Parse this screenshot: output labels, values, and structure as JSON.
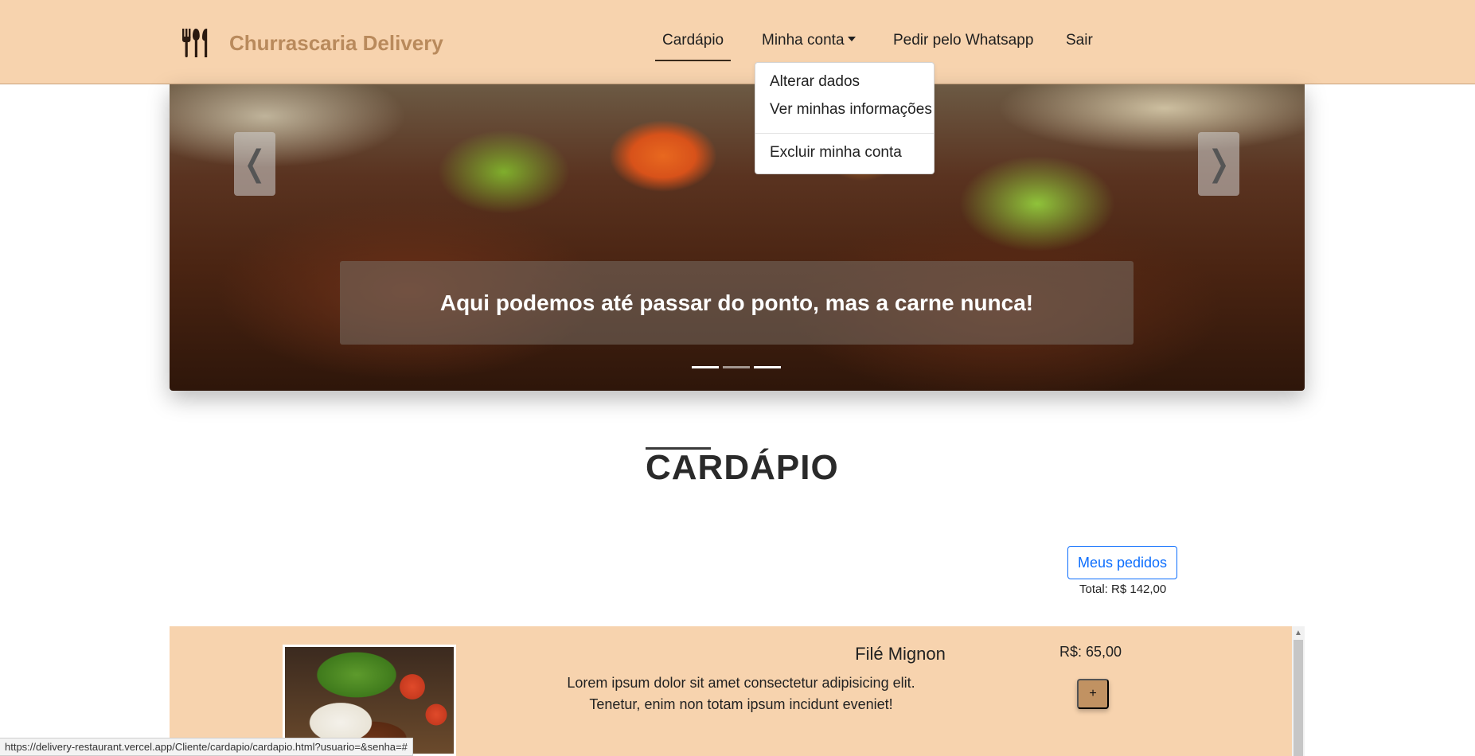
{
  "navbar": {
    "brand": "Churrascaria Delivery",
    "brand_icon": "utensils-icon",
    "links": [
      {
        "label": "Cardápio",
        "active": true
      },
      {
        "label": "Minha conta",
        "dropdown": true
      },
      {
        "label": "Pedir pelo Whatsapp"
      },
      {
        "label": "Sair"
      }
    ]
  },
  "account_dropdown": {
    "items": [
      "Alterar dados",
      "Ver minhas informações",
      "Excluir minha conta"
    ]
  },
  "carousel": {
    "caption": "Aqui podemos até passar do ponto, mas a carne nunca!",
    "prev_icon": "chevron-left-icon",
    "next_icon": "chevron-right-icon",
    "prev_glyph": "❬",
    "next_glyph": "❭",
    "slide_count": 3
  },
  "menu": {
    "heading": "CARDÁPIO",
    "orders_button": "Meus pedidos",
    "total": "Total: R$ 142,00"
  },
  "products": [
    {
      "name": "Filé Mignon",
      "description": "Lorem ipsum dolor sit amet consectetur adipisicing elit. Tenetur, enim non totam ipsum incidunt eveniet!",
      "price": "R$: 65,00",
      "add_label": "+"
    }
  ],
  "status_bar": {
    "url": "https://delivery-restaurant.vercel.app/Cliente/cardapio/cardapio.html?usuario=&senha=#"
  },
  "colors": {
    "navbar_bg": "#f7d3ae",
    "brand_text": "#b98a5c",
    "add_button": "#c19262",
    "orders_button": "#0d6efd"
  }
}
